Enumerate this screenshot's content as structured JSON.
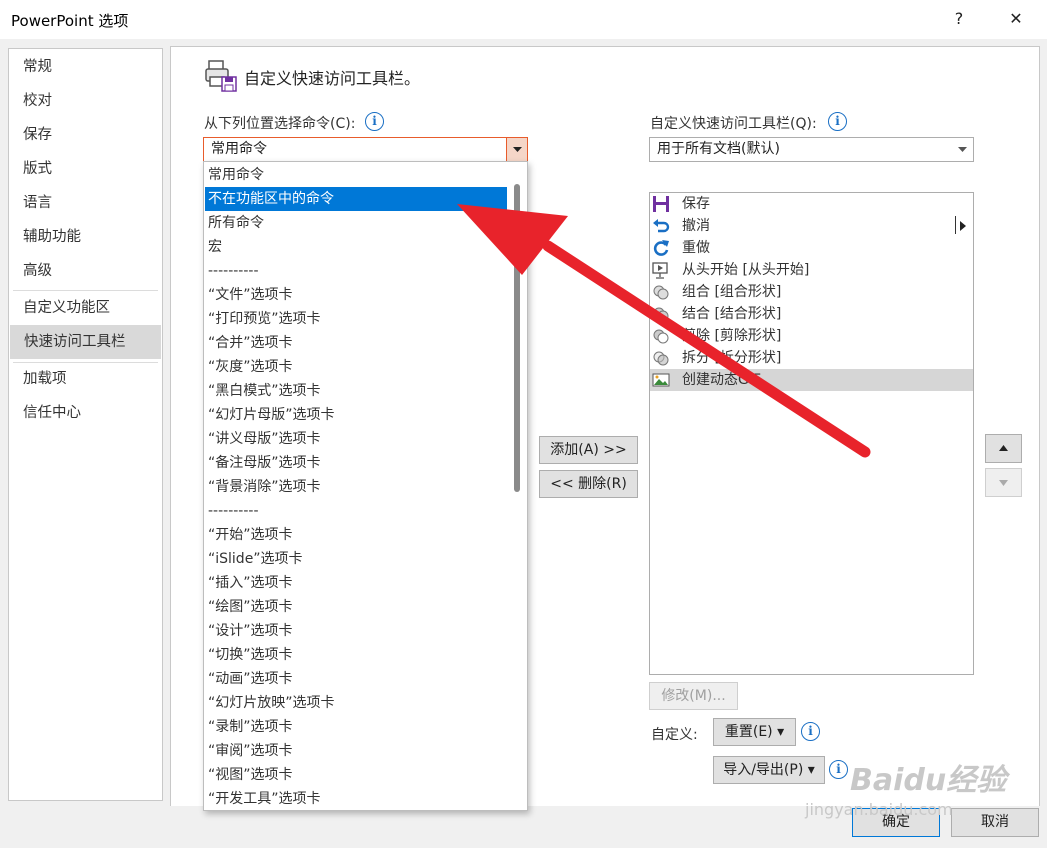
{
  "window": {
    "title": "PowerPoint 选项",
    "help_glyph": "?",
    "close_glyph": "✕"
  },
  "nav": {
    "items": [
      "常规",
      "校对",
      "保存",
      "版式",
      "语言",
      "辅助功能",
      "高级",
      "自定义功能区",
      "快速访问工具栏",
      "加载项",
      "信任中心"
    ],
    "selected": "快速访问工具栏"
  },
  "main": {
    "heading": "自定义快速访问工具栏。",
    "choose_label": "从下列位置选择命令(C):",
    "choose_value": "常用命令",
    "qat_label": "自定义快速访问工具栏(Q):",
    "qat_value": "用于所有文档(默认)",
    "add_button": "添加(A) >>",
    "remove_button": "<< 删除(R)",
    "modify_button": "修改(M)...",
    "customize_label": "自定义:",
    "reset_button": "重置(E) ▾",
    "import_export_button": "导入/导出(P) ▾"
  },
  "dropdown": {
    "selected_index": 1,
    "items": [
      "常用命令",
      "不在功能区中的命令",
      "所有命令",
      "宏",
      "----------",
      "“文件”选项卡",
      "“打印预览”选项卡",
      "“合并”选项卡",
      "“灰度”选项卡",
      "“黑白模式”选项卡",
      "“幻灯片母版”选项卡",
      "“讲义母版”选项卡",
      "“备注母版”选项卡",
      "“背景消除”选项卡",
      "----------",
      "“开始”选项卡",
      "“iSlide”选项卡",
      "“插入”选项卡",
      "“绘图”选项卡",
      "“设计”选项卡",
      "“切换”选项卡",
      "“动画”选项卡",
      "“幻灯片放映”选项卡",
      "“录制”选项卡",
      "“审阅”选项卡",
      "“视图”选项卡",
      "“开发工具”选项卡"
    ]
  },
  "qat": {
    "items": [
      {
        "icon": "save-icon",
        "label": "保存"
      },
      {
        "icon": "undo-icon",
        "label": "撤消"
      },
      {
        "icon": "redo-icon",
        "label": "重做"
      },
      {
        "icon": "slideshow-from-start-icon",
        "label": "从头开始 [从头开始]"
      },
      {
        "icon": "combine-shapes-icon",
        "label": "组合 [组合形状]"
      },
      {
        "icon": "union-shapes-icon",
        "label": "结合 [结合形状]"
      },
      {
        "icon": "subtract-shapes-icon",
        "label": "剪除 [剪除形状]"
      },
      {
        "icon": "fragment-shapes-icon",
        "label": "拆分 [拆分形状]"
      },
      {
        "icon": "create-gif-icon",
        "label": "创建动态GIF"
      }
    ],
    "selected_index": 8
  },
  "footer": {
    "ok_button": "确定",
    "cancel_button": "取消"
  },
  "watermark": {
    "logo": "Baidu经验",
    "url": "jingyan.baidu.com"
  },
  "colors": {
    "selection_blue": "#0078d7",
    "arrow_red": "#e8232b",
    "info_blue": "#1a6fc4"
  }
}
